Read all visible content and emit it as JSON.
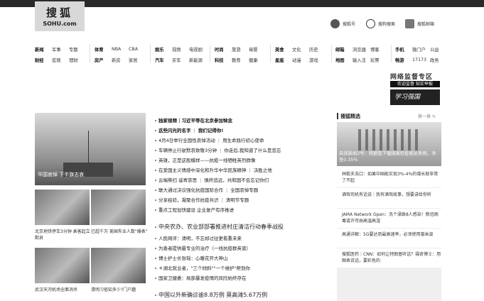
{
  "logo": {
    "cn": "搜狐",
    "en": "SOHU.com"
  },
  "tools": [
    {
      "label": "搜狐号",
      "icon": "sohu-account-icon"
    },
    {
      "label": "搜狗搜索",
      "icon": "sogou-search-icon"
    },
    {
      "label": "搜狐邮箱",
      "icon": "mail-icon"
    }
  ],
  "nav": [
    {
      "row1": [
        "新闻",
        "军事",
        "专题"
      ],
      "row2": [
        "财经",
        "宏观",
        "理财"
      ]
    },
    {
      "row1": [
        "体育",
        "NBA",
        "CBA"
      ],
      "row2": [
        "房产",
        "新房",
        "家居"
      ]
    },
    {
      "row1": [
        "娱乐",
        "视频",
        "电视剧"
      ],
      "row2": [
        "汽车",
        "买车",
        "新能源"
      ]
    },
    {
      "row1": [
        "时尚",
        "旅游",
        "母婴"
      ],
      "row2": [
        "科技",
        "教育",
        "健康"
      ]
    },
    {
      "row1": [
        "美食",
        "文化",
        "历史"
      ],
      "row2": [
        "星座",
        "动漫",
        "游戏"
      ]
    },
    {
      "row1": [
        "邮箱",
        "浏览器",
        "博客"
      ],
      "row2": [
        "地图",
        "输入法",
        "彩票"
      ]
    },
    {
      "row1": [
        "手机",
        "微门户",
        "公益"
      ],
      "row2": [
        "畅游",
        "17173",
        "政务"
      ]
    }
  ],
  "ad": {
    "line1": "网络监督专区",
    "line2": "欢迎监督 知实举报",
    "line3": "学习强国"
  },
  "hero": {
    "caption": "华国哀悼 下半旗志哀"
  },
  "thumbs": [
    {
      "caption": "北京地铁停车3分钟 乘客起立默哀"
    },
    {
      "caption": "已超千万 美国失业人数\"爆表\""
    },
    {
      "caption": "武汉天河机场全面消杀"
    },
    {
      "caption": "清明习俗知多少?门户趣"
    }
  ],
  "news": [
    {
      "parts": [
        "独家视频｜习近平等在北京参加悼念"
      ],
      "strong": true
    },
    {
      "parts": [
        "这些闪光的名字",
        "我们记得你!"
      ],
      "strong": true
    },
    {
      "parts": [
        "4月4日举行全国性哀悼活动",
        "用生命践行初心使命"
      ]
    },
    {
      "parts": [
        "车辆停止行驶默哀致敬3分钟",
        "你走后,我知道了什么是悲忘"
      ]
    },
    {
      "parts": [
        "英雄，正是这般模样——抗疫一线牺牲英烈群像"
      ]
    },
    {
      "parts": [
        "在爱国主义情感中深化和升华中华民族精神",
        "决胜之地"
      ]
    },
    {
      "parts": [
        "云端祭扫 遥寄哀思",
        "慎终追远，共和国不会忘记你们"
      ]
    },
    {
      "parts": [
        "联大通过决议强化抗疫国际合作",
        "全国哀悼专题"
      ]
    },
    {
      "parts": [
        "分享经验，凝聚合作抗疫共识",
        "清明节专题"
      ]
    },
    {
      "parts": [
        "重点工程加快建设 企业复产有序推进"
      ]
    },
    {
      "parts": [
        "中央农办、农业部部署推进村庄清洁行动春季战役"
      ],
      "big": true
    },
    {
      "parts": [
        "人民网评：清明，不忘却过往更看重未来"
      ]
    },
    {
      "parts": [
        "为患者提供最专业的治疗（一线抗疫群英谱）"
      ]
    },
    {
      "parts": [
        "博士护士长张瑶：心暖花开大神山"
      ]
    },
    {
      "parts": [
        "＊湖北就业者，\"三个倾斜\"\"一个维护\"帮到你"
      ]
    },
    {
      "parts": [
        "国家卫健委：局部暴发疫情的风险始终存在"
      ]
    },
    {
      "parts": [
        "中国以外新确诊逾8.8万例 莫高滩5.67万例"
      ],
      "big": true
    }
  ],
  "side": {
    "title": "搜狐精选",
    "switch": "换一换",
    "photo_caption": "央视新闻2号：特朗普下载隔离检疫相关条例，净至0.35%",
    "items": [
      "林毅夫浩口：如果中国能实现3%-4%的增长就非常了不起",
      "酒驾司机有话说｜我有酒驾故事，想要讲给你听",
      "JAMA Network Open：洗个澡致8人感染！新冠病毒或许可由高温高湿",
      "高通详解：5G要达到最高速率，必须使用毫米波",
      "搜狐医药｜CNN：如何让特朗普听话？福奇博士：用图表说话，要彩色的"
    ]
  }
}
